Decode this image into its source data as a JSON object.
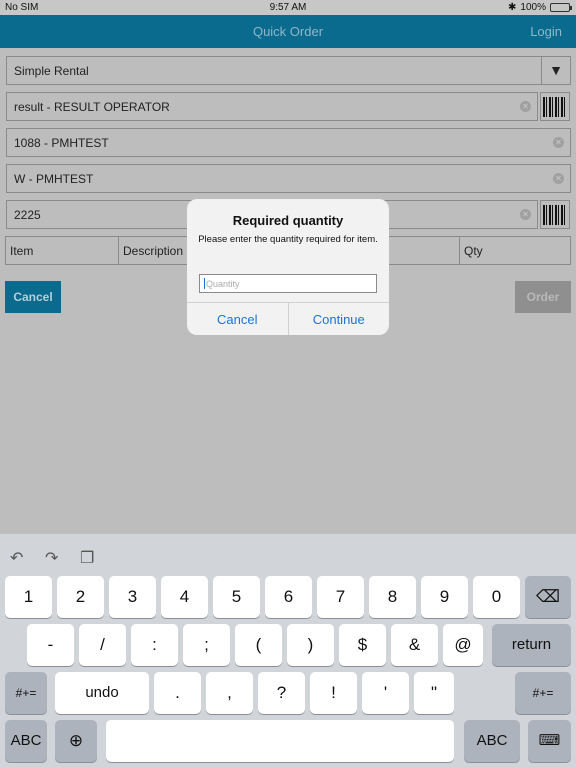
{
  "status_bar": {
    "carrier": "No SIM",
    "time": "9:57 AM",
    "battery": "100%",
    "battery_level": 1.0
  },
  "nav": {
    "title": "Quick Order",
    "login": "Login"
  },
  "form": {
    "rental_type": "Simple Rental",
    "operator": "result - RESULT OPERATOR",
    "customer": "1088 - PMHTEST",
    "location": "W - PMHTEST",
    "item_code": "2225"
  },
  "table": {
    "headers": [
      "Item",
      "Description",
      "Qty"
    ]
  },
  "buttons": {
    "cancel": "Cancel",
    "order": "Order"
  },
  "dialog": {
    "title": "Required quantity",
    "message": "Please enter the quantity required for item.",
    "placeholder": "Quantity",
    "cancel": "Cancel",
    "continue": "Continue"
  },
  "keyboard": {
    "row1": [
      "1",
      "2",
      "3",
      "4",
      "5",
      "6",
      "7",
      "8",
      "9",
      "0"
    ],
    "row2": [
      "-",
      "/",
      ":",
      ";",
      "(",
      ")",
      "$",
      "&",
      "@"
    ],
    "return": "return",
    "shift_left": "#+=",
    "shift_right": "#+=",
    "undo": "undo",
    "row3": [
      ".",
      ",",
      "?",
      "!",
      "'",
      "\""
    ],
    "abc_left": "ABC",
    "abc_right": "ABC"
  }
}
